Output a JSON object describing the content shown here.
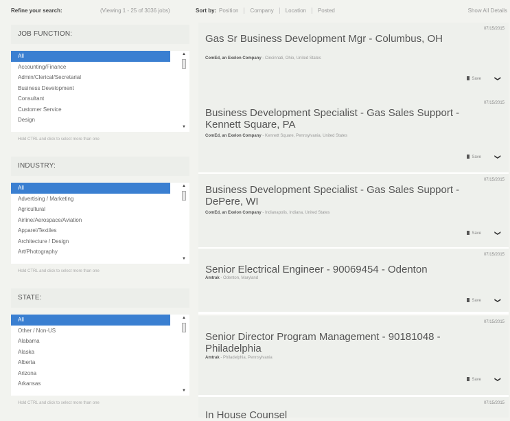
{
  "topbar": {
    "refine_label": "Refine your search:",
    "viewing": "(Viewing 1 - 25 of 3036 jobs)",
    "sort_label": "Sort by:",
    "sort_options": [
      "Position",
      "Company",
      "Location",
      "Posted"
    ],
    "show_all": "Show All Details"
  },
  "filters": {
    "job_function": {
      "heading": "JOB FUNCTION:",
      "options": [
        "All",
        "Accounting/Finance",
        "Admin/Clerical/Secretarial",
        "Business Development",
        "Consultant",
        "Customer Service",
        "Design"
      ],
      "selected": "All",
      "hint": "Hold CTRL and click to select more than one"
    },
    "industry": {
      "heading": "INDUSTRY:",
      "options": [
        "All",
        "Advertising / Marketing",
        "Agricultural",
        "Airline/Aerospace/Aviation",
        "Apparel/Textiles",
        "Architecture / Design",
        "Art/Photography"
      ],
      "selected": "All",
      "hint": "Hold CTRL and click to select more than one"
    },
    "state": {
      "heading": "STATE:",
      "options": [
        "All",
        "Other / Non-US",
        "Alabama",
        "Alaska",
        "Alberta",
        "Arizona",
        "Arkansas"
      ],
      "selected": "All",
      "hint": "Hold CTRL and click to select more than one"
    }
  },
  "jobs": [
    {
      "date": "07/15/2015",
      "title": "Gas Sr Business Development Mgr - Columbus, OH",
      "company": "ComEd, an Exelon Company",
      "location": "Cincinnati, Ohio, United States",
      "save": "Save"
    },
    {
      "date": "07/15/2015",
      "title": "Business Development Specialist - Gas Sales Support - Kennett Square, PA",
      "company": "ComEd, an Exelon Company",
      "location": "Kennett Square, Pennsylvania, United States",
      "save": "Save"
    },
    {
      "date": "07/15/2015",
      "title": "Business Development Specialist - Gas Sales Support - DePere, WI",
      "company": "ComEd, an Exelon Company",
      "location": "Indianapolis, Indiana, United States",
      "save": "Save"
    },
    {
      "date": "07/15/2015",
      "title": "Senior Electrical Engineer - 90069454 - Odenton",
      "company": "Amtrak",
      "location": "Odenton, Maryland",
      "save": "Save"
    },
    {
      "date": "07/15/2015",
      "title": "Senior Director Program Management - 90181048 - Philadelphia",
      "company": "Amtrak",
      "location": "Philadelphia, Pennsylvania",
      "save": "Save"
    },
    {
      "date": "07/15/2015",
      "title": "In House Counsel",
      "company": "",
      "location": "",
      "save": ""
    }
  ],
  "separator": " - "
}
